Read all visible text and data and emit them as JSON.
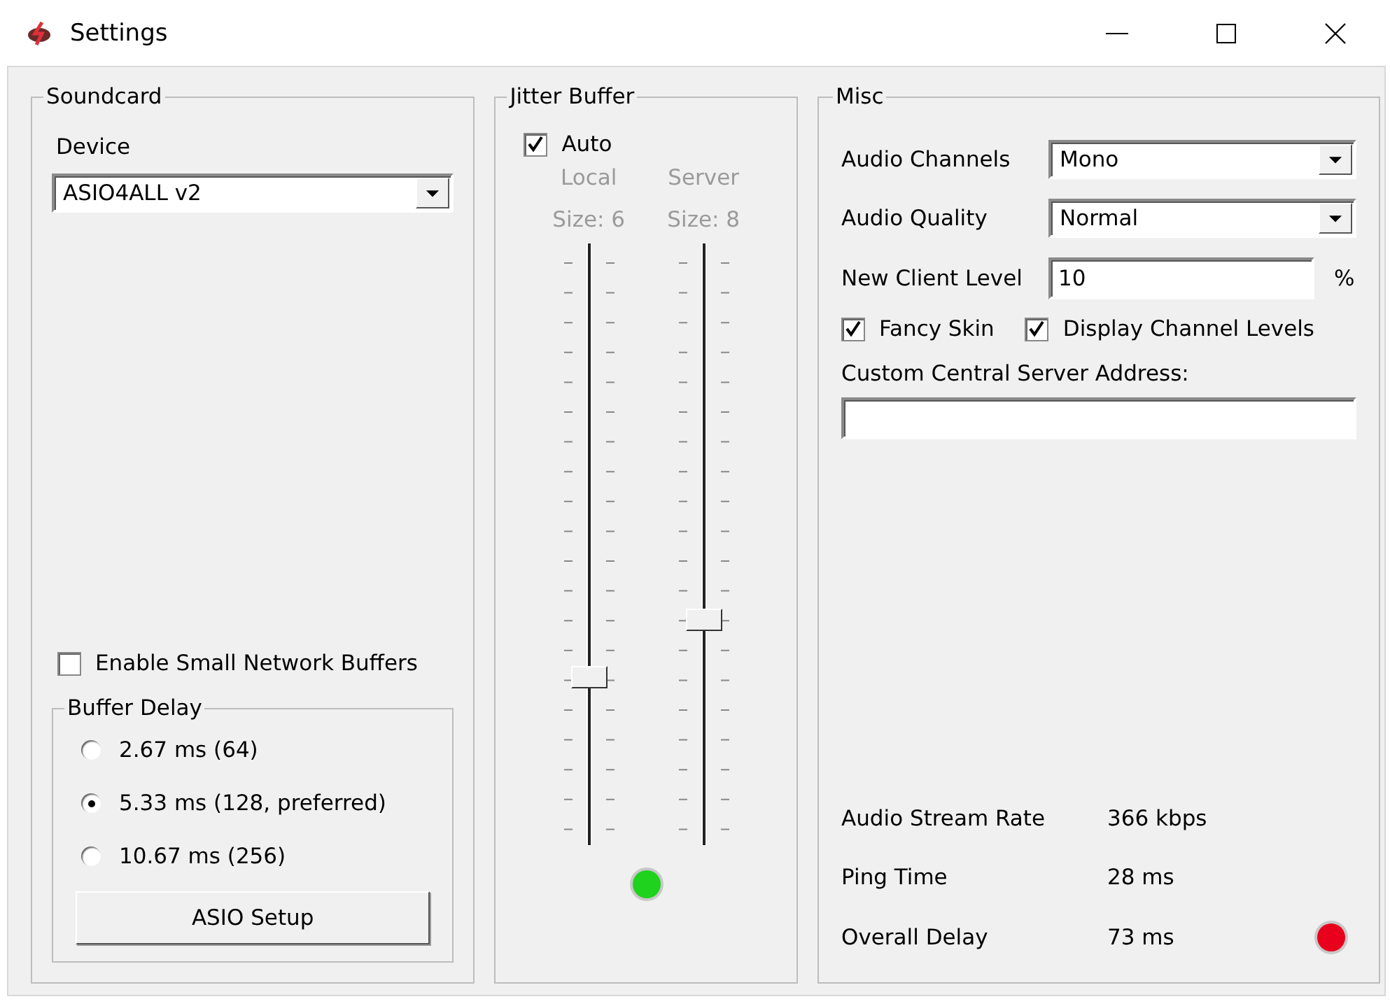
{
  "window": {
    "title": "Settings"
  },
  "soundcard": {
    "title": "Soundcard",
    "device_label": "Device",
    "device": "ASIO4ALL v2",
    "small_buffers": {
      "label": "Enable Small Network Buffers",
      "checked": false
    },
    "buffer_delay": {
      "title": "Buffer Delay",
      "options": [
        {
          "label": "2.67 ms (64)",
          "selected": false
        },
        {
          "label": "5.33 ms (128, preferred)",
          "selected": true
        },
        {
          "label": "10.67 ms (256)",
          "selected": false
        }
      ]
    },
    "setup_button": "ASIO Setup"
  },
  "jitter_buffer": {
    "title": "Jitter Buffer",
    "auto": {
      "label": "Auto",
      "checked": true
    },
    "sliders": [
      {
        "name": "Local",
        "size": "Size: 6",
        "level": 0.27,
        "disabled": true
      },
      {
        "name": "Server",
        "size": "Size: 8",
        "level": 0.37,
        "disabled": true
      }
    ],
    "status_led": {
      "color": "#1ed21e"
    }
  },
  "misc": {
    "title": "Misc",
    "audio_channels": {
      "label": "Audio Channels",
      "value": "Mono"
    },
    "audio_quality": {
      "label": "Audio Quality",
      "value": "Normal"
    },
    "new_client_level": {
      "label": "New Client Level",
      "value": "10",
      "unit": "%"
    },
    "checkboxes": [
      {
        "label": "Fancy Skin",
        "checked": true
      },
      {
        "label": "Display Channel Levels",
        "checked": true
      }
    ],
    "server_address_label": "Custom Central Server Address:",
    "stats": [
      {
        "label": "Audio Stream Rate",
        "value": "366 kbps"
      },
      {
        "label": "Ping Time",
        "value": "28 ms"
      },
      {
        "label": "Overall Delay",
        "value": "73 ms"
      }
    ],
    "delay_led": {
      "color": "#e8001c"
    }
  }
}
